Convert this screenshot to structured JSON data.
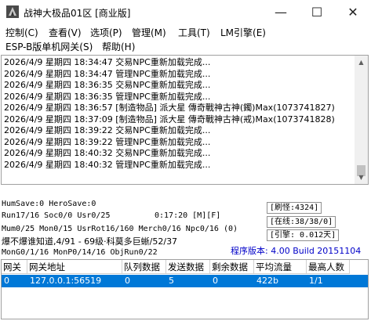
{
  "window": {
    "title": "战神大极品01区 [商业版]",
    "minimize": "—",
    "maximize": "☐",
    "close": "✕"
  },
  "menu": {
    "items": [
      "控制(C)",
      "查看(V)",
      "选项(P)",
      "管理(M)",
      "工具(T)",
      "LM引擎(E)",
      "ESP-B版单机网关(S)",
      "帮助(H)"
    ]
  },
  "log": {
    "lines": [
      "2026/4/9 星期四 18:34:47 交易NPC重新加载完成...",
      "2026/4/9 星期四 18:34:47 管理NPC重新加载完成...",
      "2026/4/9 星期四 18:36:35 交易NPC重新加载完成...",
      "2026/4/9 星期四 18:36:35 管理NPC重新加载完成...",
      "2026/4/9 星期四 18:36:57 [制造物品] 派大星 傳奇戰神古神(鐲)Max(1073741827)",
      "2026/4/9 星期四 18:37:09 [制造物品] 派大星 傳奇戰神古神(戒)Max(1073741828)",
      "2026/4/9 星期四 18:39:22 交易NPC重新加载完成...",
      "2026/4/9 星期四 18:39:22 管理NPC重新加载完成...",
      "2026/4/9 星期四 18:40:32 交易NPC重新加载完成...",
      "2026/4/9 星期四 18:40:32 管理NPC重新加载完成..."
    ]
  },
  "status": {
    "line1": "HumSave:0 HeroSave:0",
    "line2": "Run17/16 Soc0/0 Usr0/25",
    "timer": "0:17:20 [M][F]",
    "line3": "Mum0/25 Mon0/15 UsrRot16/160 Merch0/16 Npc0/16 (0)",
    "line4": "爆不爆谁知道,4/91 - 69级·科莫多巨蜥/52/37",
    "line5": "MonG0/1/16 MonP0/14/16 ObjRun0/22",
    "monster": "[刷怪:4324]",
    "online": "[在线:38/38/0]",
    "engine": "[引擎: 0.012天]",
    "version": "程序版本: 4.00 Build 20151104"
  },
  "gateway_table": {
    "columns": [
      "网关",
      "网关地址",
      "队列数据",
      "发送数据",
      "剩余数据",
      "平均流量",
      "最高人数"
    ],
    "rows": [
      [
        "0",
        "127.0.0.1:56519",
        "0",
        "5",
        "0",
        "422b",
        "1/1"
      ]
    ]
  }
}
